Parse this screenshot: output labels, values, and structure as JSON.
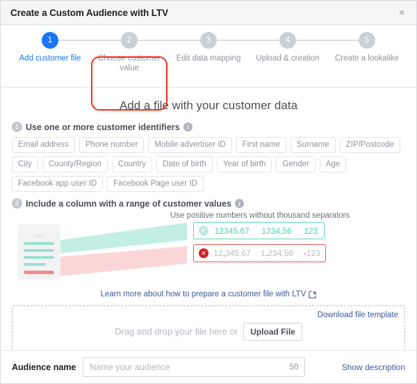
{
  "window": {
    "title": "Create a Custom Audience with LTV",
    "close_label": "×"
  },
  "stepper": {
    "steps": [
      {
        "number": "1",
        "label": "Add customer file",
        "state": "active"
      },
      {
        "number": "2",
        "label": "Choose customer value",
        "state": "inactive"
      },
      {
        "number": "3",
        "label": "Edit data mapping",
        "state": "inactive"
      },
      {
        "number": "4",
        "label": "Upload & creation",
        "state": "inactive"
      },
      {
        "number": "5",
        "label": "Create a lookalike",
        "state": "inactive"
      }
    ],
    "highlight_color": "#fc2b1b",
    "active_color": "#1877f2",
    "inactive_color": "#ccd0d5"
  },
  "main": {
    "heading": "Add a file with your customer data",
    "section1": {
      "number": "1",
      "title": "Use one or more customer identifiers",
      "info": "i",
      "chips": [
        "Email address",
        "Phone number",
        "Mobile advertiser ID",
        "First name",
        "Surname",
        "ZIP/Postcode",
        "City",
        "County/Region",
        "Country",
        "Date of birth",
        "Year of birth",
        "Gender",
        "Age",
        "Facebook app user ID",
        "Facebook Page user ID"
      ]
    },
    "section2": {
      "number": "2",
      "title": "Include a column with a range of customer values",
      "info": "i",
      "caption": "Use positive numbers without thousand separators",
      "file_label": ".csv",
      "valid": {
        "mark": "✔",
        "values": [
          "12345.67",
          "1234,56",
          "123"
        ],
        "color": "#4fcfb2",
        "border": "#5ed5bb"
      },
      "invalid": {
        "mark": "✕",
        "values": [
          {
            "pre": "12",
            "sep": ",",
            "post": "345.67"
          },
          {
            "pre": "1",
            "sep": ".",
            "post": "234,56"
          },
          {
            "pre": "",
            "sep": "-",
            "post": "123"
          }
        ],
        "color": "#b9bcc2",
        "border": "#ef5350"
      }
    },
    "learn_more": "Learn more about how to prepare a customer file with LTV",
    "dropzone": {
      "text": "Drag and drop your file here or",
      "upload_button": "Upload File",
      "download_template": "Download file template"
    }
  },
  "footer": {
    "audience_label": "Audience name",
    "audience_value": "",
    "audience_placeholder": "Name your audience",
    "counter": "50",
    "show_description": "Show description"
  }
}
